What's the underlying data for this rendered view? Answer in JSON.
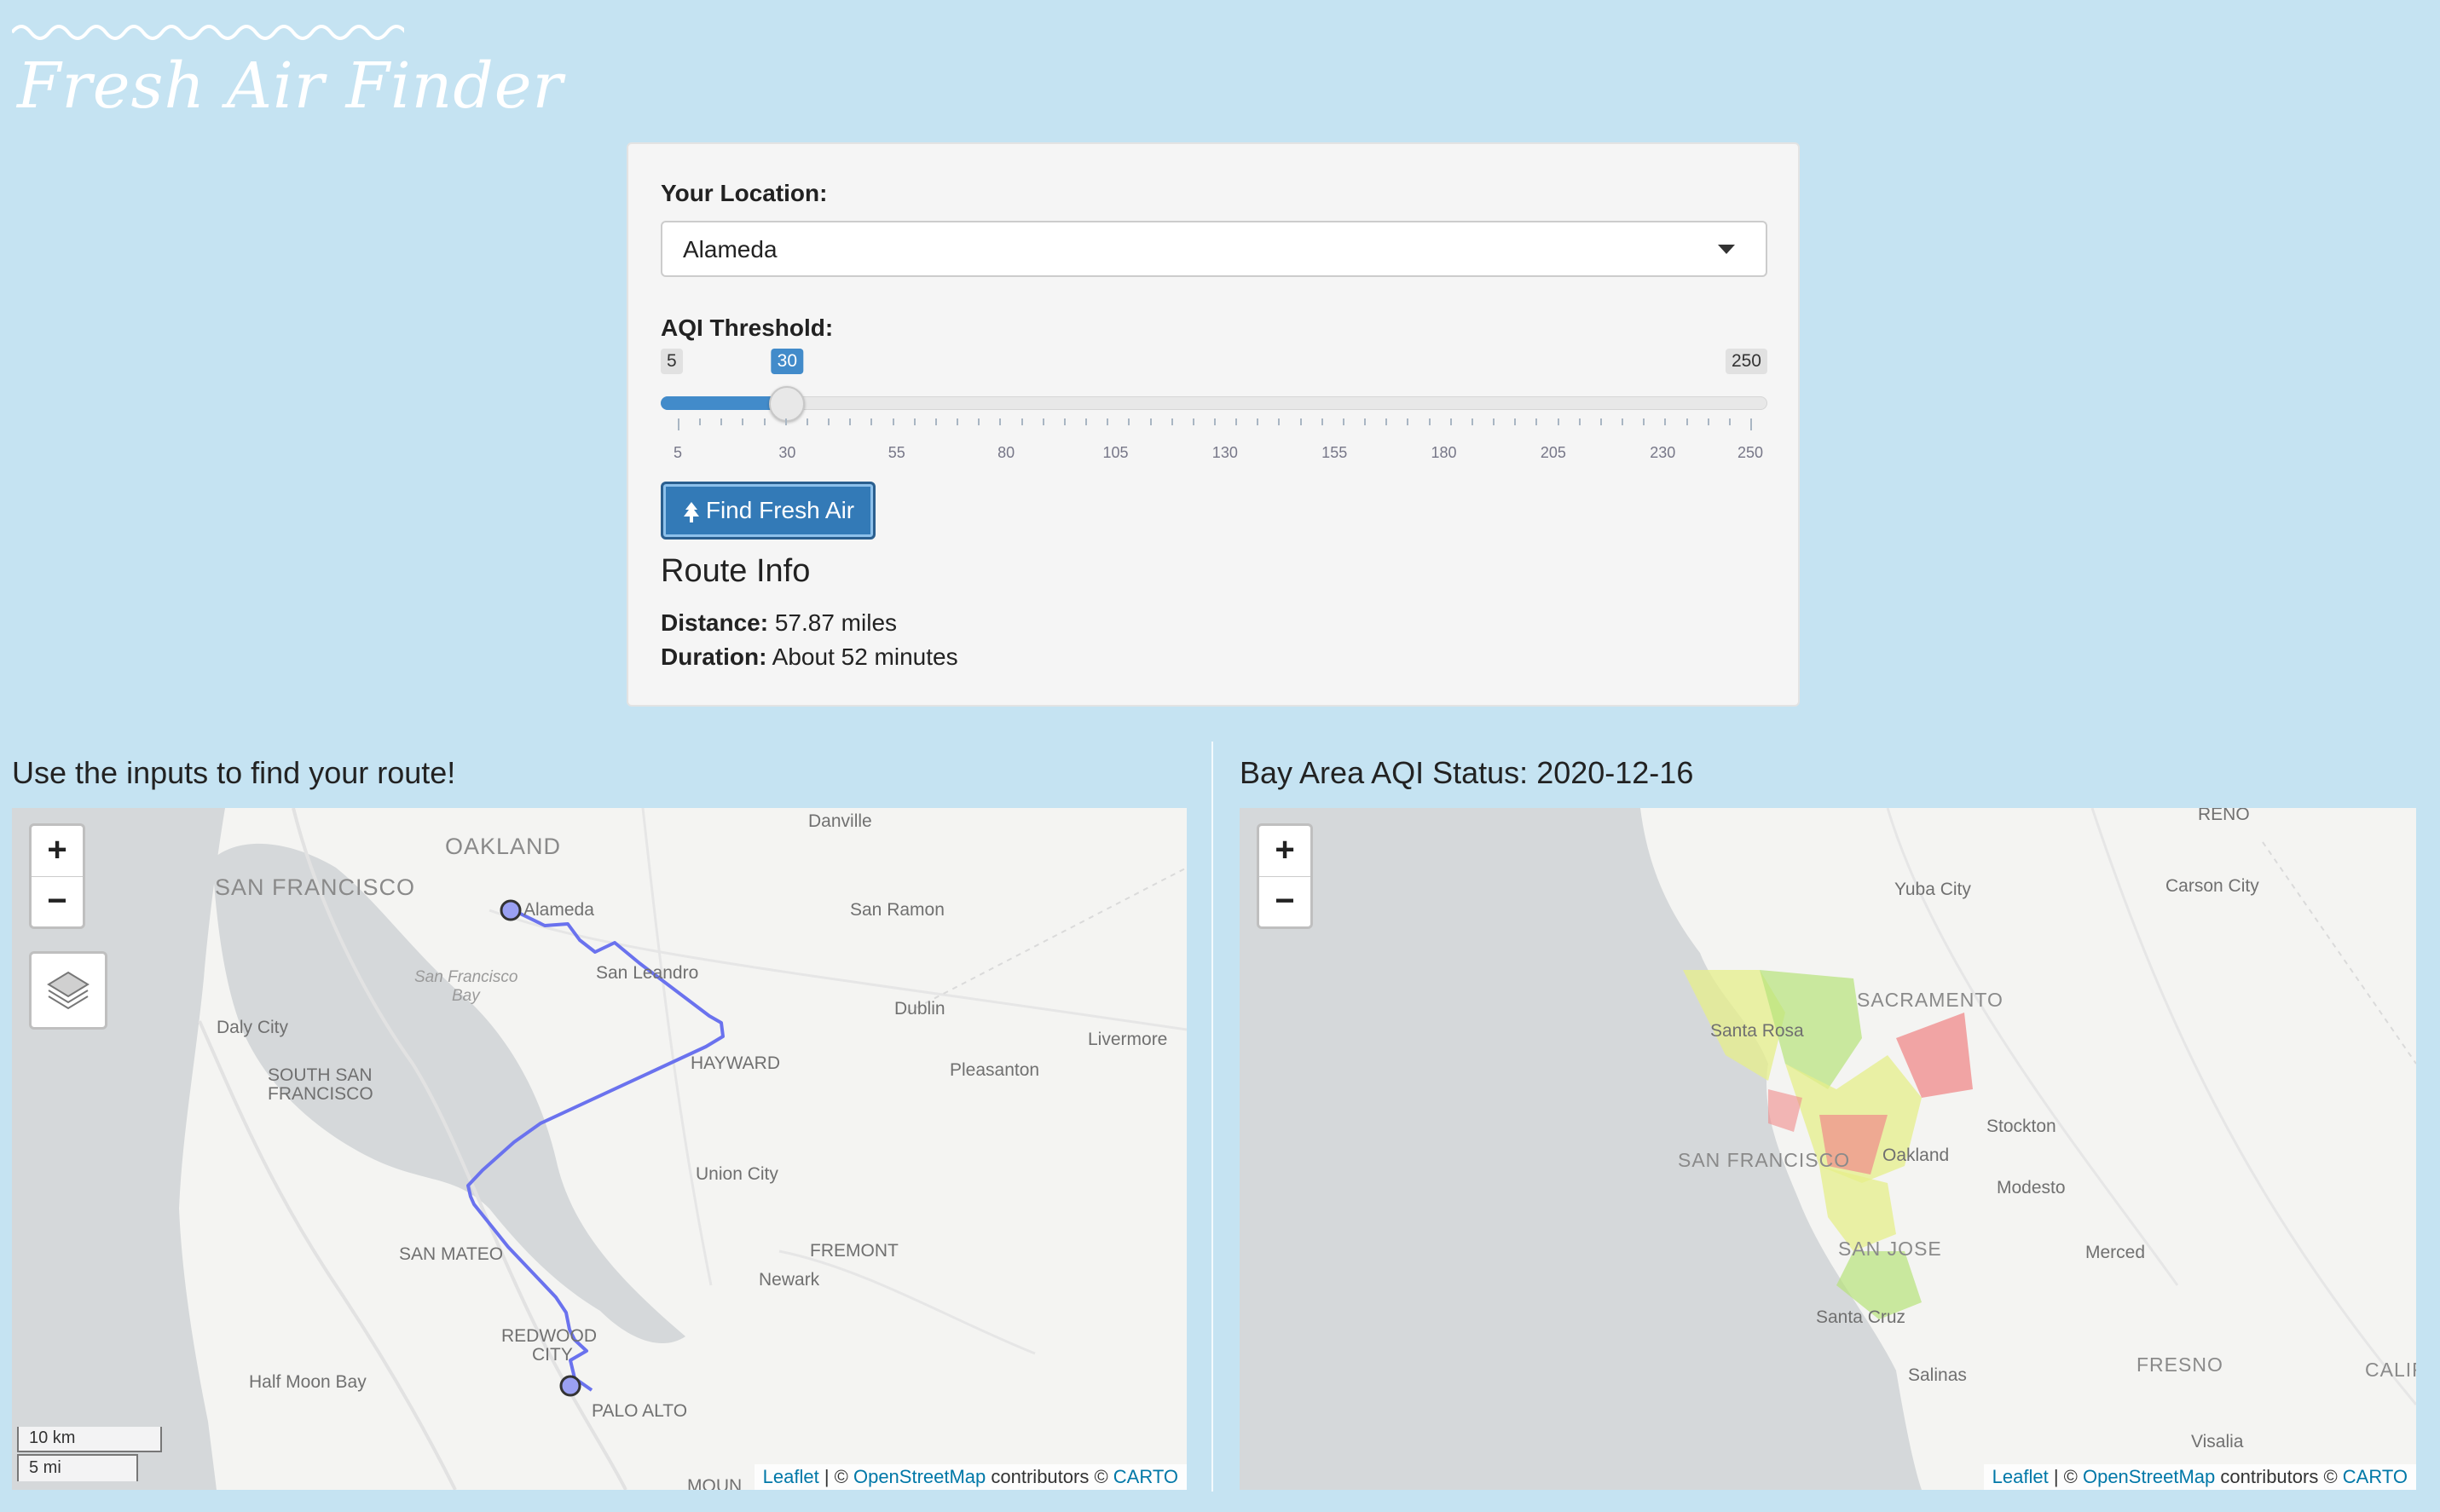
{
  "app": {
    "title": "Fresh Air Finder"
  },
  "controls": {
    "location_label": "Your Location:",
    "location_value": "Alameda",
    "threshold_label": "AQI Threshold:",
    "slider": {
      "min": 5,
      "max": 250,
      "value": 30,
      "min_label": "5",
      "max_label": "250",
      "value_label": "30",
      "tick_labels": [
        "5",
        "30",
        "55",
        "80",
        "105",
        "130",
        "155",
        "180",
        "205",
        "230",
        "250"
      ]
    },
    "button_label": "Find Fresh Air",
    "button_icon": "tree-icon"
  },
  "route_info": {
    "title": "Route Info",
    "distance_label": "Distance:",
    "distance_value": "57.87 miles",
    "duration_label": "Duration:",
    "duration_value": "About 52 minutes"
  },
  "left_map": {
    "title": "Use the inputs to find your route!",
    "zoom_in": "+",
    "zoom_out": "−",
    "scale_km": "10 km",
    "scale_mi": "5 mi",
    "places": {
      "oakland": "OAKLAND",
      "danville": "Danville",
      "san_francisco": "SAN FRANCISCO",
      "alameda": "Alameda",
      "san_ramon": "San Ramon",
      "sf_bay": "San Francisco",
      "sf_bay2": "Bay",
      "san_leandro": "San Leandro",
      "dublin": "Dublin",
      "daly_city": "Daly City",
      "livermore": "Livermore",
      "hayward": "HAYWARD",
      "pleasanton": "Pleasanton",
      "south_sf1": "SOUTH SAN",
      "south_sf2": "FRANCISCO",
      "union_city": "Union City",
      "fremont": "FREMONT",
      "san_mateo": "SAN MATEO",
      "newark": "Newark",
      "redwood1": "REDWOOD",
      "redwood2": "CITY",
      "half_moon_bay": "Half Moon Bay",
      "palo_alto": "PALO ALTO",
      "mountain": "MOUN"
    }
  },
  "right_map": {
    "title": "Bay Area AQI Status: 2020-12-16",
    "zoom_in": "+",
    "zoom_out": "−",
    "places": {
      "reno": "RENO",
      "yuba_city": "Yuba City",
      "carson_city": "Carson City",
      "sacramento": "SACRAMENTO",
      "santa_rosa": "Santa Rosa",
      "stockton": "Stockton",
      "san_francisco": "SAN FRANCISCO",
      "oakland": "Oakland",
      "modesto": "Modesto",
      "san_jose": "SAN JOSE",
      "merced": "Merced",
      "santa_cruz": "Santa Cruz",
      "fresno": "FRESNO",
      "salinas": "Salinas",
      "calif": "CALIF",
      "visalia": "Visalia"
    }
  },
  "attribution": {
    "leaflet": "Leaflet",
    "sep1": " | © ",
    "osm": "OpenStreetMap",
    "mid": " contributors © ",
    "carto": "CARTO"
  },
  "colors": {
    "page_bg": "#c5e3f2",
    "accent": "#428bca",
    "button": "#337ab7",
    "route": "#6a72ee",
    "aqi_good": "#e6ef8a",
    "aqi_moderate": "#b7e37a",
    "aqi_unhealthy": "#f08a8a"
  }
}
